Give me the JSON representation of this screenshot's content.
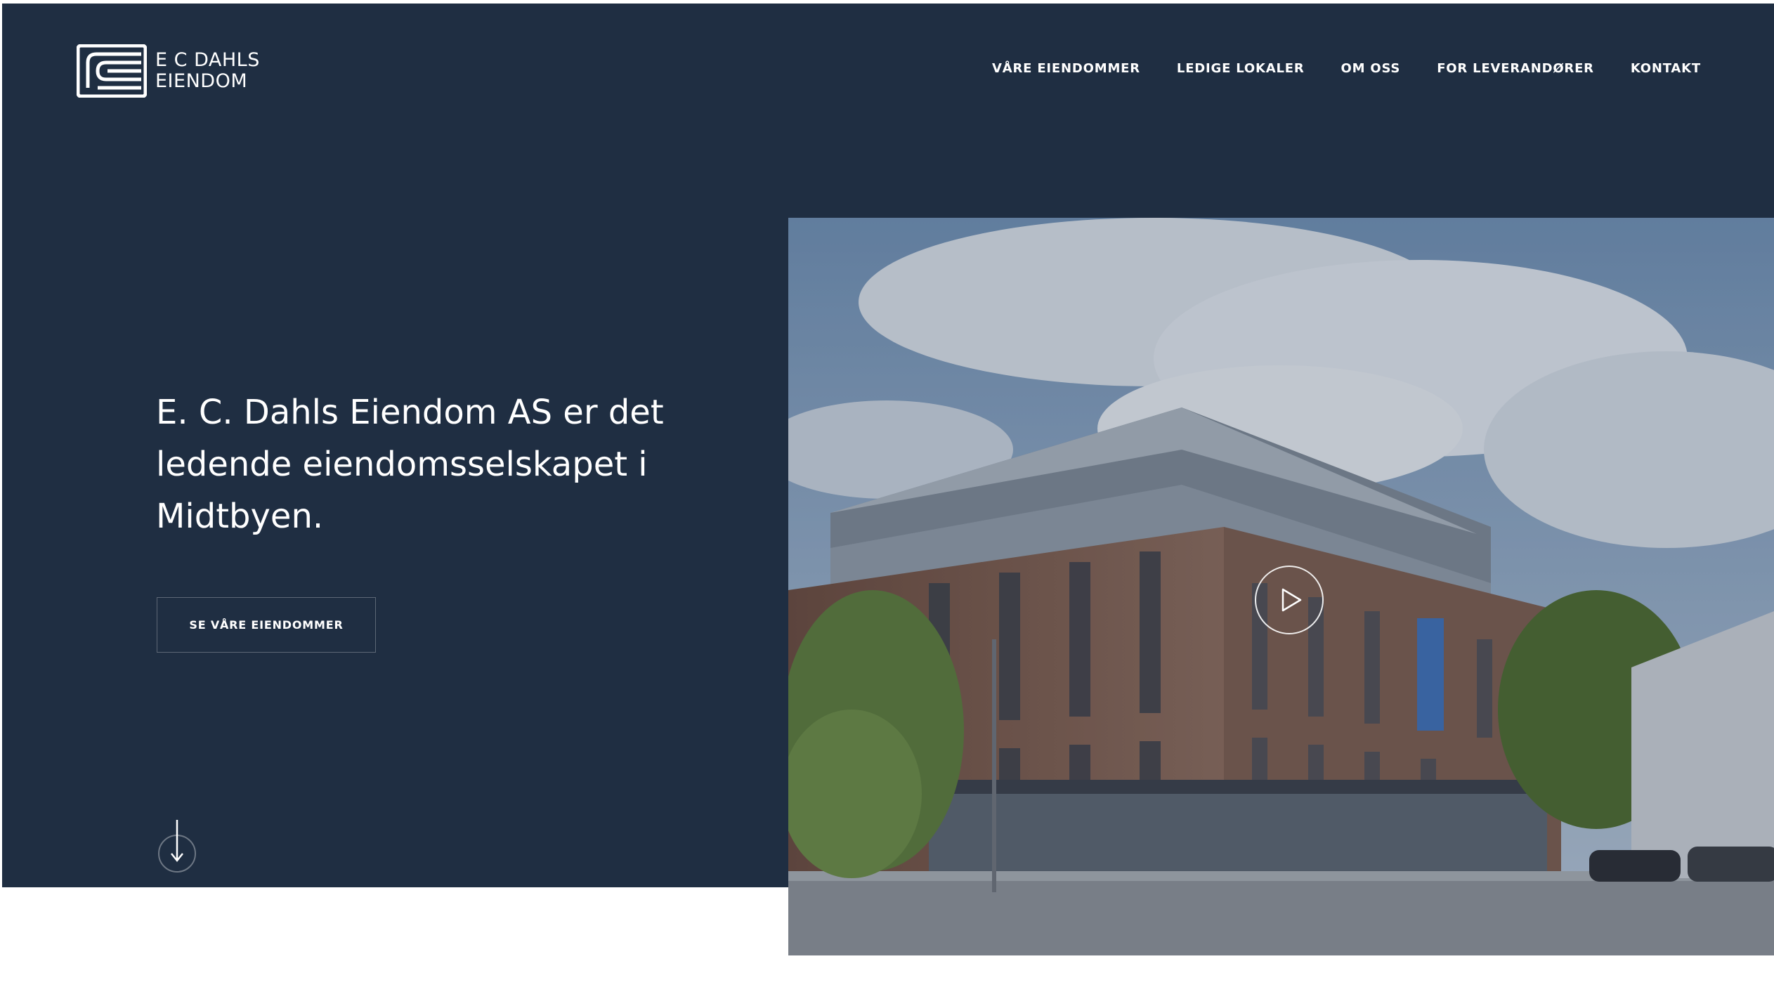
{
  "brand": {
    "line1": "E C DAHLS",
    "line2": "EIENDOM"
  },
  "nav": {
    "items": [
      {
        "label": "VÅRE EIENDOMMER"
      },
      {
        "label": "LEDIGE LOKALER"
      },
      {
        "label": "OM OSS"
      },
      {
        "label": "FOR LEVERANDØRER"
      },
      {
        "label": "KONTAKT"
      }
    ]
  },
  "hero": {
    "headline_lines": [
      "E. C. Dahls Eiendom AS er det",
      "ledende eiendomsselskapet i",
      "Midtbyen."
    ],
    "cta_label": "SE VÅRE EIENDOMMER",
    "scroll_icon": "arrow-down-icon",
    "play_icon": "play-icon"
  },
  "colors": {
    "hero_background": "#1f2e42",
    "text": "#ffffff",
    "page_background": "#ffffff"
  }
}
